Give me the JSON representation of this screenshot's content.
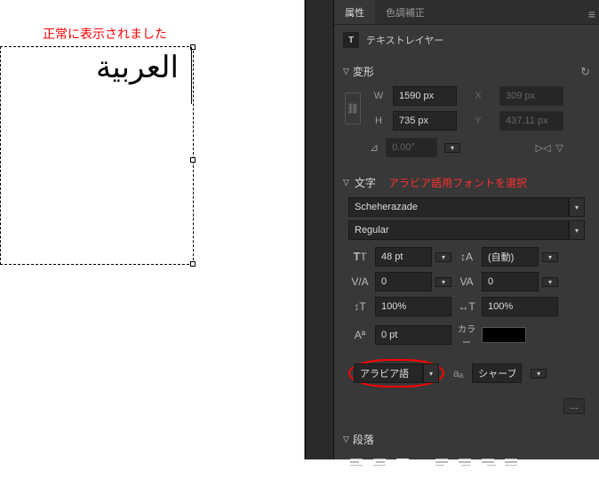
{
  "canvas": {
    "annotation_top": "正常に表示されました",
    "arabic_text": "العربية"
  },
  "panel": {
    "tabs": {
      "properties": "属性",
      "color_correction": "色調補正"
    },
    "layer": {
      "type_icon": "T",
      "name": "テキストレイヤー"
    },
    "transform": {
      "title": "変形",
      "w_label": "W",
      "w_value": "1590 px",
      "h_label": "H",
      "h_value": "735 px",
      "x_label": "X",
      "x_value": "309 px",
      "y_label": "Y",
      "y_value": "437.11 px",
      "angle_value": "0.00°"
    },
    "character": {
      "title": "文字",
      "annotation": "アラビア語用フォントを選択",
      "font_family": "Scheherazade",
      "font_style": "Regular",
      "size": "48 pt",
      "leading": "(自動)",
      "tracking": "0",
      "kerning": "0",
      "vscale": "100%",
      "hscale": "100%",
      "baseline": "0 pt",
      "color_label": "カラー",
      "language": "アラビア語",
      "antialiasing": "シャープ",
      "more": "…"
    },
    "paragraph": {
      "title": "段落"
    }
  }
}
